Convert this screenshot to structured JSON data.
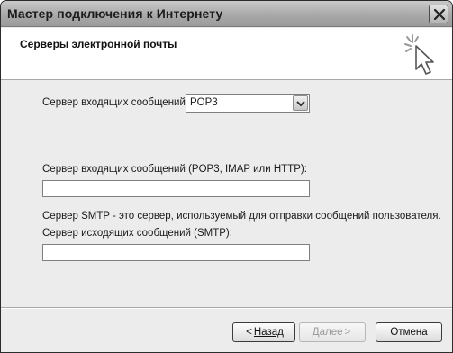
{
  "window": {
    "title": "Мастер подключения к Интернету"
  },
  "header": {
    "title": "Серверы электронной почты"
  },
  "form": {
    "incoming_server_type_label": "Сервер входящих сообщений:",
    "incoming_server_type_value": "POP3",
    "incoming_server_label": "Сервер входящих сообщений (POP3, IMAP или HTTP):",
    "incoming_server_value": "",
    "smtp_description": "Сервер SMTP - это сервер, используемый для отправки сообщений  пользователя.",
    "outgoing_server_label": "Сервер исходящих сообщений (SMTP):",
    "outgoing_server_value": ""
  },
  "buttons": {
    "back_arrow": "<",
    "back_label": "Назад",
    "next_label": "Далее",
    "next_arrow": ">",
    "cancel_label": "Отмена"
  },
  "icons": {
    "close": "close-icon",
    "wizard": "wizard-sparkle-cursor-icon",
    "dropdown": "chevron-down-icon"
  }
}
